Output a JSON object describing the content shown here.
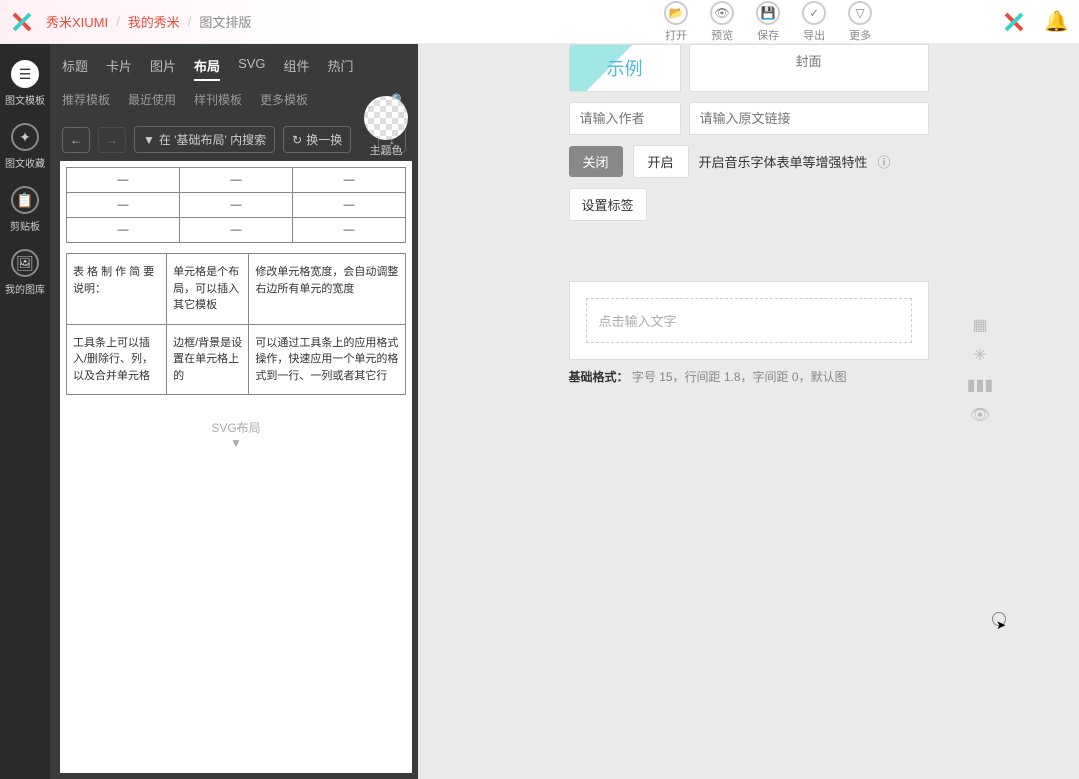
{
  "breadcrumb": {
    "brand": "秀米XIUMI",
    "mine": "我的秀米",
    "current": "图文排版"
  },
  "topActions": {
    "open": "打开",
    "preview": "预览",
    "save": "保存",
    "export": "导出",
    "more": "更多"
  },
  "leftnav": {
    "template": "图文模板",
    "favorites": "图文收藏",
    "clipboard": "剪贴板",
    "gallery": "我的图库"
  },
  "tabs": {
    "title": "标题",
    "card": "卡片",
    "image": "图片",
    "layout": "布局",
    "svg": "SVG",
    "component": "组件",
    "hot": "热门"
  },
  "tabs2": {
    "recommend": "推荐模板",
    "recent": "最近使用",
    "sample": "样刊模板",
    "more": "更多模板"
  },
  "theme": "主题色",
  "toolbar": {
    "searchIn": "在 '基础布局' 内搜索",
    "swap": "换一换"
  },
  "emptyTable": {
    "dash": "—"
  },
  "descTable": {
    "r1c1": "表 格 制 作 简 要 说明：",
    "r1c2": "单元格是个布局，可以插入其它模板",
    "r1c3": "修改单元格宽度，会自动调整右边所有单元的宽度",
    "r2c1": "工具条上可以插入/删除行、列，以及合并单元格",
    "r2c2": "边框/背景是设置在单元格上的",
    "r2c3": "可以通过工具条上的应用格式操作，快速应用一个单元的格式到一行、一列或者其它行"
  },
  "svgLayout": "SVG布局",
  "doc": {
    "thumb": "示例",
    "cover": "封面",
    "authorPlaceholder": "请输入作者",
    "linkPlaceholder": "请输入原文链接",
    "close": "关闭",
    "open": "开启",
    "featureText": "开启音乐字体表单等增强特性",
    "tags": "设置标签",
    "editorPlaceholder": "点击输入文字"
  },
  "format": {
    "label": "基础格式：",
    "text": "字号 15，行间距 1.8，字间距 0，默认图"
  }
}
